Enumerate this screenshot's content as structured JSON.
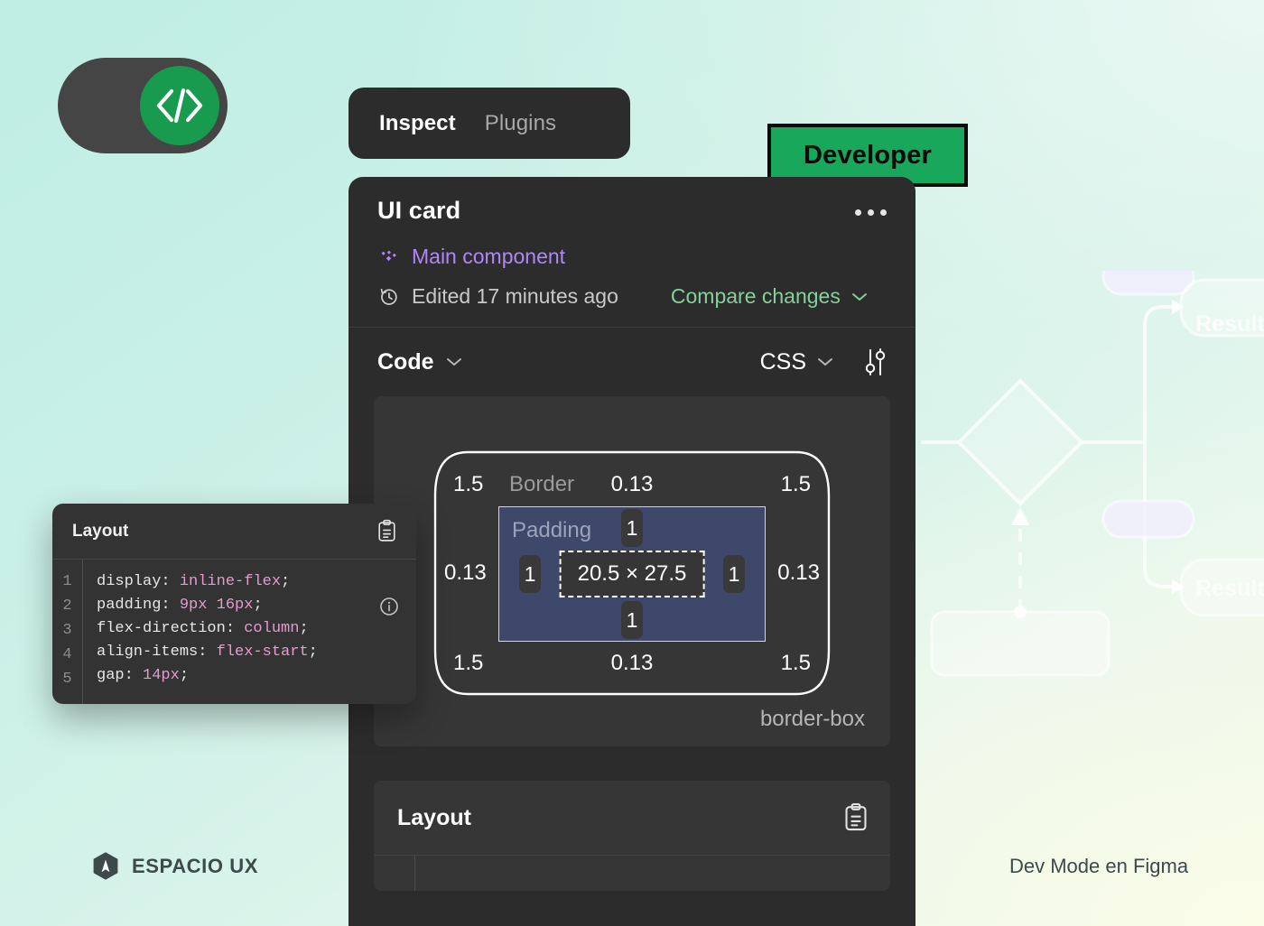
{
  "background": {
    "gradient_from": "#bfeee4",
    "gradient_to": "#f3f8e9",
    "flowchart_labels": [
      "Resultado",
      "Resultado"
    ]
  },
  "toggle": {
    "name": "dev-mode-toggle",
    "state": "on",
    "track_color": "#454545",
    "knob_color": "#189b4e",
    "icon": "code-brackets-icon"
  },
  "tabs": [
    {
      "label": "Inspect",
      "active": true
    },
    {
      "label": "Plugins",
      "active": false
    }
  ],
  "badge": {
    "label": "Developer",
    "fill": "#19a75b",
    "stroke": "#0b0b0b"
  },
  "cursor": {
    "name": "figma-cursor",
    "fill": "#19a75b"
  },
  "panel": {
    "title": "UI card",
    "overflow_menu": "...",
    "component_label": "Main component",
    "component_color": "#b087f7",
    "edited_label": "Edited 17 minutes ago",
    "compare_label": "Compare changes",
    "compare_color": "#86d09a",
    "code_label": "Code",
    "language_label": "CSS",
    "settings_icon": "sliders-icon",
    "box_model": {
      "border_label": "Border",
      "padding_label": "Padding",
      "corner_top_left": "1.5",
      "corner_top_right": "1.5",
      "corner_bottom_left": "1.5",
      "corner_bottom_right": "1.5",
      "border_top": "0.13",
      "border_right": "0.13",
      "border_bottom": "0.13",
      "border_left": "0.13",
      "padding_top": "1",
      "padding_right": "1",
      "padding_bottom": "1",
      "padding_left": "1",
      "content_size": "20.5 × 27.5",
      "box_sizing": "border-box",
      "padding_fill": "#3e486b"
    },
    "layout_section": {
      "title": "Layout",
      "copy_icon": "clipboard-icon"
    }
  },
  "code_card": {
    "title": "Layout",
    "copy_icon": "clipboard-icon",
    "info_icon": "info-icon",
    "line_numbers": [
      "1",
      "2",
      "3",
      "4",
      "5"
    ],
    "lines": [
      {
        "prop": "display: ",
        "value": "inline-flex",
        "end": ";"
      },
      {
        "prop": "padding: ",
        "value": "9px 16px",
        "end": ";"
      },
      {
        "prop": "flex-direction: ",
        "value": "column",
        "end": ";"
      },
      {
        "prop": "align-items: ",
        "value": "flex-start",
        "end": ";"
      },
      {
        "prop": "gap: ",
        "value": "14px",
        "end": ";"
      }
    ]
  },
  "footer": {
    "logo_name": "ESPACIO UX",
    "logo_icon": "hexagon-pin-icon",
    "caption": "Dev Mode en Figma"
  }
}
